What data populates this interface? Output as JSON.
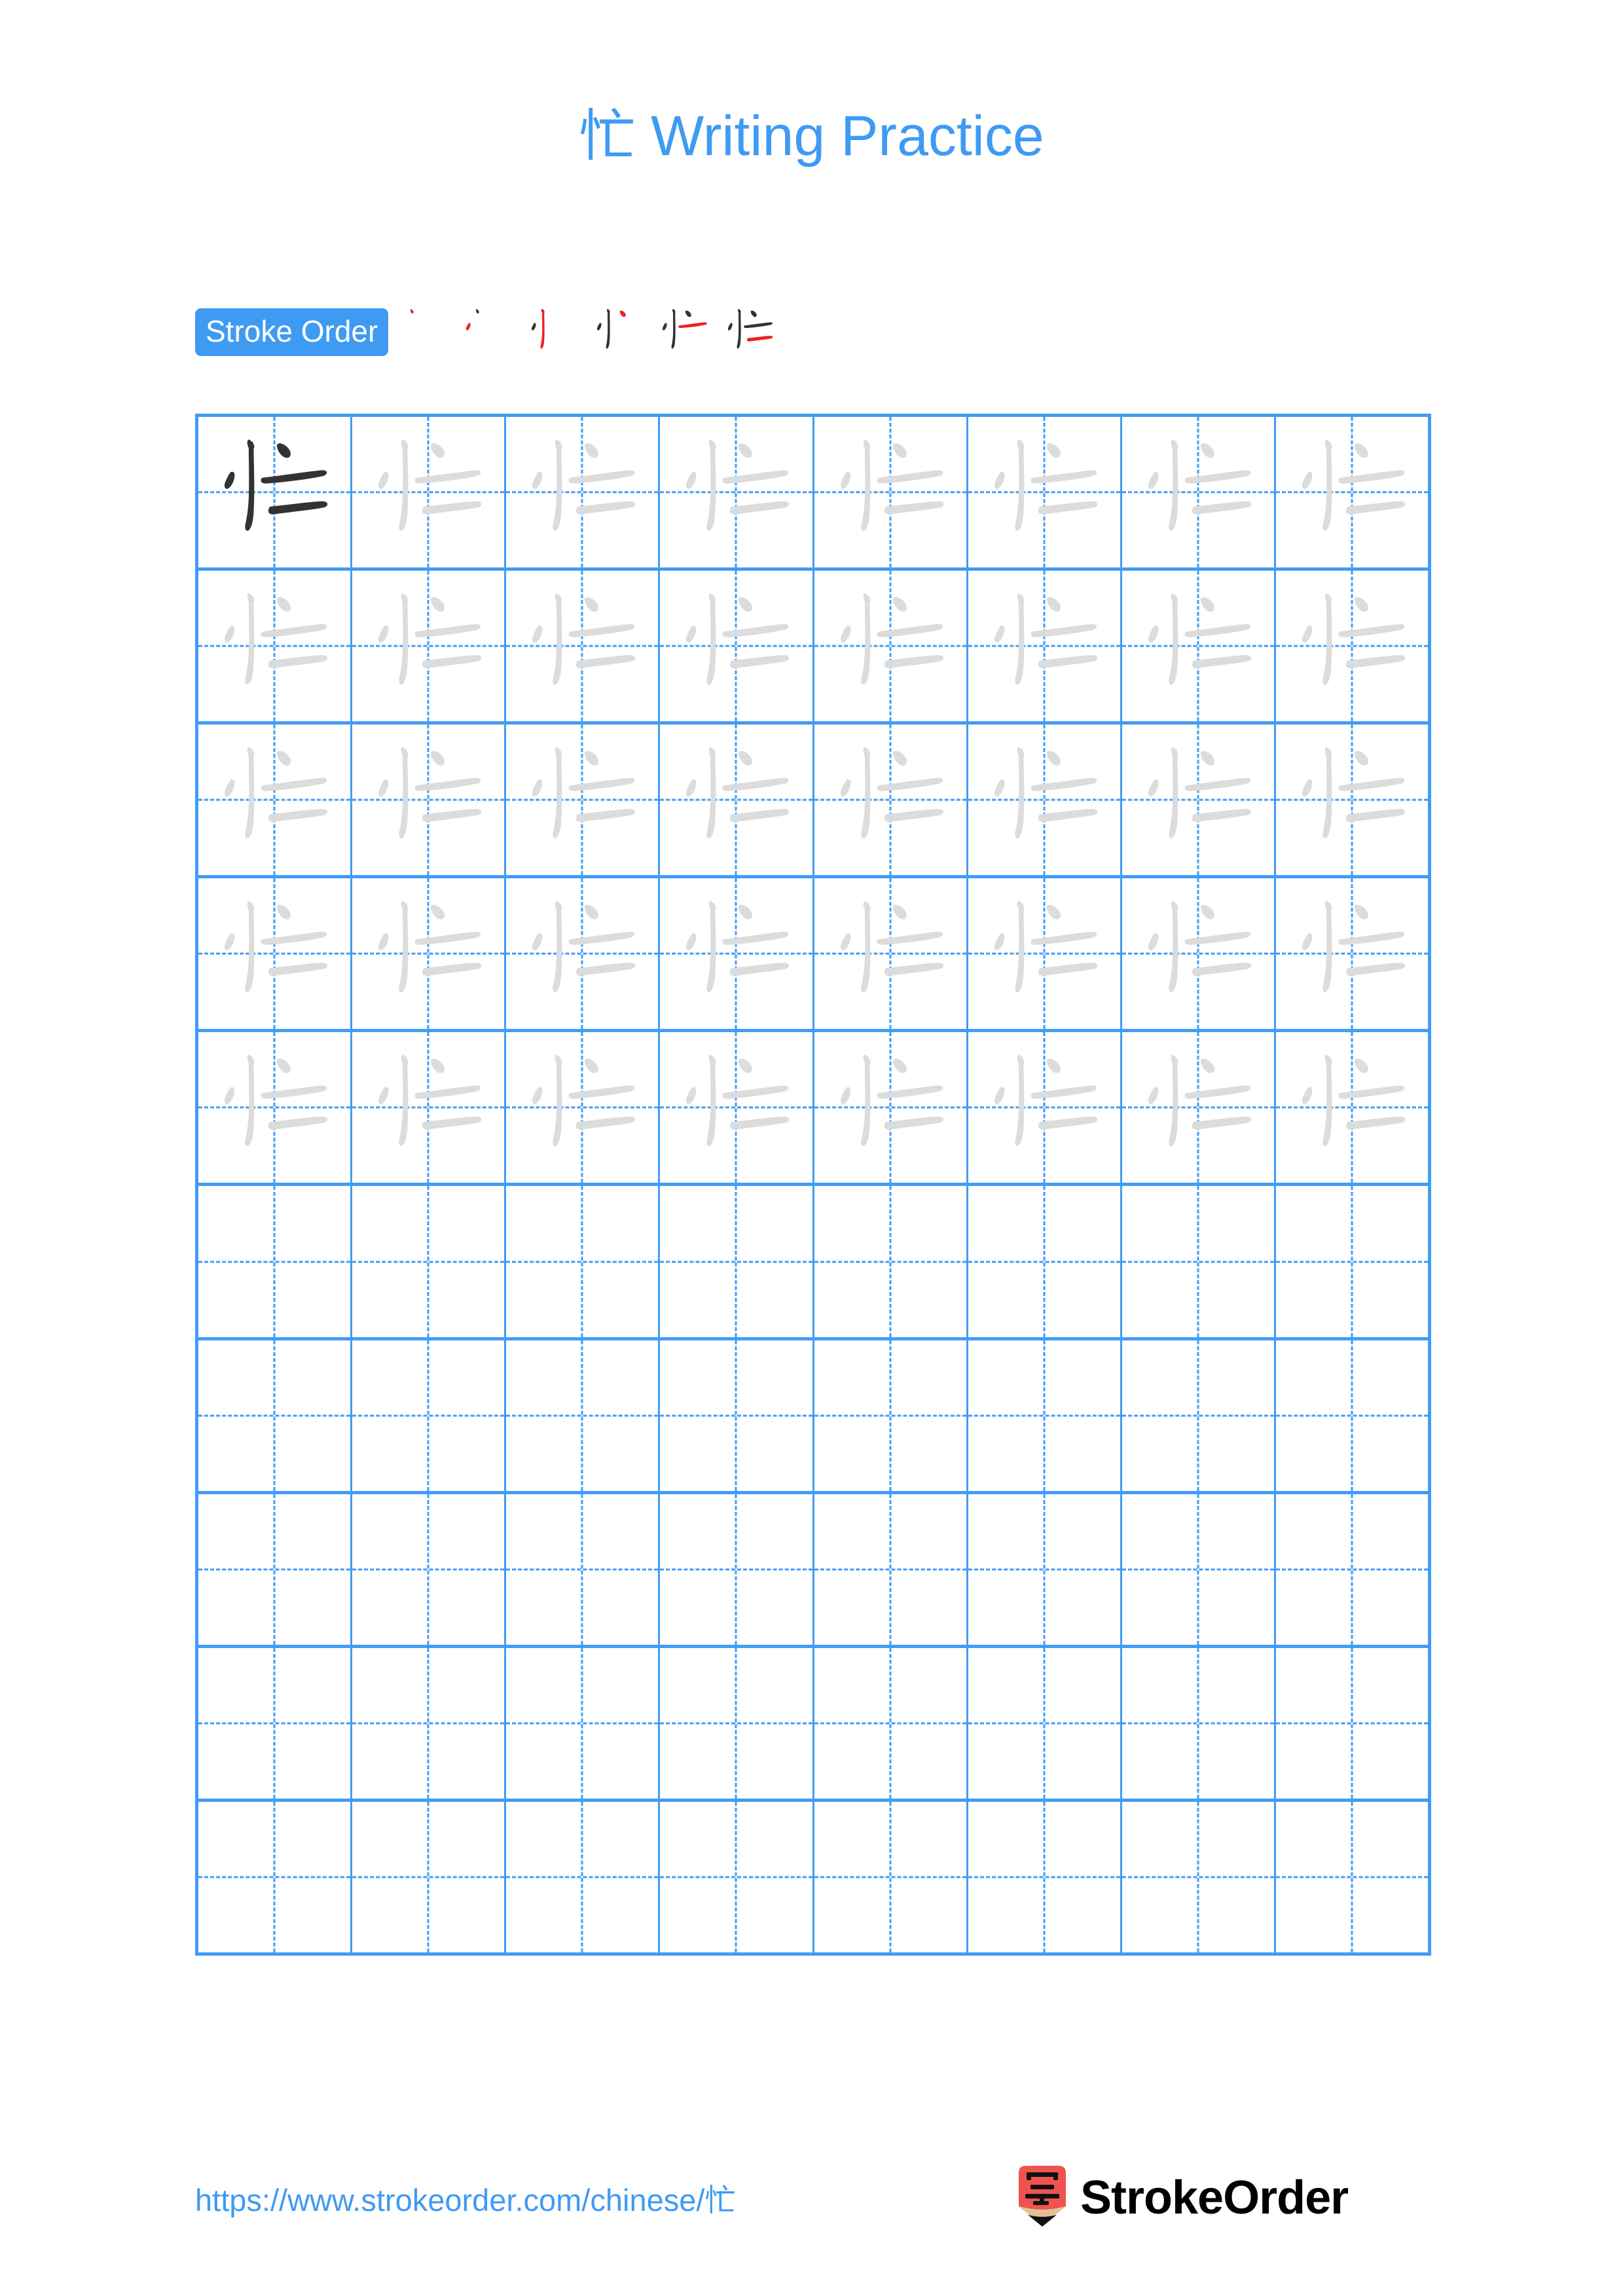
{
  "page": {
    "character": "忙",
    "background_color": "#ffffff",
    "accent_color": "#3f9bf2",
    "grid_line_color": "#419cf5",
    "trace_glyph_color": "#dcdcdc",
    "solid_glyph_color": "#333333",
    "new_stroke_color": "#ee2222"
  },
  "header": {
    "title": "忙 Writing Practice"
  },
  "stroke_order": {
    "badge_label": "Stroke Order",
    "stage_count": 6,
    "stages": [
      {
        "index": 1,
        "strokes_shown": 1,
        "new_stroke": 1
      },
      {
        "index": 2,
        "strokes_shown": 2,
        "new_stroke": 2
      },
      {
        "index": 3,
        "strokes_shown": 3,
        "new_stroke": 3
      },
      {
        "index": 4,
        "strokes_shown": 4,
        "new_stroke": 4
      },
      {
        "index": 5,
        "strokes_shown": 5,
        "new_stroke": 5
      },
      {
        "index": 6,
        "strokes_shown": 6,
        "new_stroke": 6
      }
    ]
  },
  "practice_grid": {
    "columns": 8,
    "rows": 10,
    "cells": [
      [
        "solid",
        "trace",
        "trace",
        "trace",
        "trace",
        "trace",
        "trace",
        "trace"
      ],
      [
        "trace",
        "trace",
        "trace",
        "trace",
        "trace",
        "trace",
        "trace",
        "trace"
      ],
      [
        "trace",
        "trace",
        "trace",
        "trace",
        "trace",
        "trace",
        "trace",
        "trace"
      ],
      [
        "trace",
        "trace",
        "trace",
        "trace",
        "trace",
        "trace",
        "trace",
        "trace"
      ],
      [
        "trace",
        "trace",
        "trace",
        "trace",
        "trace",
        "trace",
        "trace",
        "trace"
      ],
      [
        "empty",
        "empty",
        "empty",
        "empty",
        "empty",
        "empty",
        "empty",
        "empty"
      ],
      [
        "empty",
        "empty",
        "empty",
        "empty",
        "empty",
        "empty",
        "empty",
        "empty"
      ],
      [
        "empty",
        "empty",
        "empty",
        "empty",
        "empty",
        "empty",
        "empty",
        "empty"
      ],
      [
        "empty",
        "empty",
        "empty",
        "empty",
        "empty",
        "empty",
        "empty",
        "empty"
      ],
      [
        "empty",
        "empty",
        "empty",
        "empty",
        "empty",
        "empty",
        "empty",
        "empty"
      ]
    ]
  },
  "footer": {
    "url": "https://www.strokeorder.com/chinese/忙",
    "brand_name": "StrokeOrder",
    "logo_character": "字",
    "logo_body_color": "#f0534f",
    "logo_wood_color": "#e2c295",
    "logo_tip_color": "#111111"
  }
}
